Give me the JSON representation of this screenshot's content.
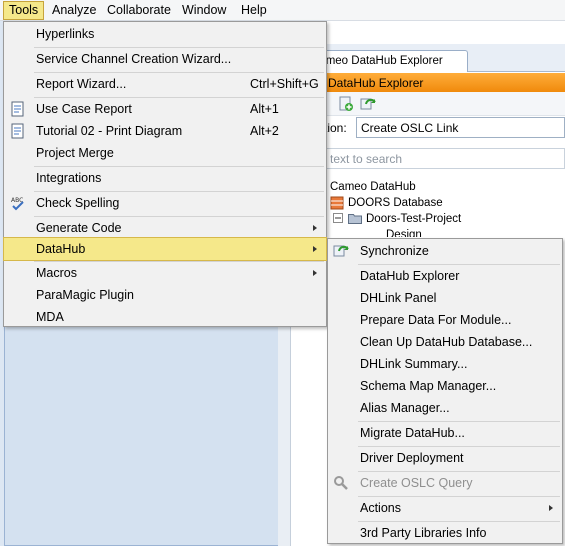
{
  "menubar": {
    "items": [
      {
        "label": "Tools"
      },
      {
        "label": "Analyze"
      },
      {
        "label": "Collaborate"
      },
      {
        "label": "Window"
      },
      {
        "label": "Help"
      }
    ]
  },
  "datahub_explorer": {
    "tab_label": "Cameo DataHub Explorer",
    "title": "DataHub Explorer",
    "action_label": "tion:",
    "action_value": "Create OSLC Link",
    "search_placeholder": "text to search",
    "tree": {
      "root": "Cameo DataHub",
      "db": "DOORS Database",
      "project": "Doors-Test-Project",
      "child": "Design"
    }
  },
  "tools_menu": {
    "items": {
      "hyperlinks": "Hyperlinks",
      "service_channel": "Service Channel Creation Wizard...",
      "report_wizard": "Report Wizard...",
      "report_wizard_sc": "Ctrl+Shift+G",
      "use_case_report": "Use Case Report",
      "use_case_report_sc": "Alt+1",
      "tutorial": "Tutorial 02 - Print Diagram",
      "tutorial_sc": "Alt+2",
      "project_merge": "Project Merge",
      "integrations": "Integrations",
      "check_spelling": "Check Spelling",
      "generate_code": "Generate Code",
      "datahub": "DataHub",
      "macros": "Macros",
      "paramagic": "ParaMagic Plugin",
      "mda": "MDA"
    }
  },
  "datahub_menu": {
    "items": {
      "synchronize": "Synchronize",
      "explorer": "DataHub Explorer",
      "dhlink_panel": "DHLink Panel",
      "prepare": "Prepare Data For Module...",
      "clean_up": "Clean Up DataHub Database...",
      "dhlink_summary": "DHLink Summary...",
      "schema_map": "Schema Map Manager...",
      "alias": "Alias Manager...",
      "migrate": "Migrate DataHub...",
      "driver": "Driver Deployment",
      "create_oslc": "Create OSLC Query",
      "actions": "Actions",
      "third_party": "3rd Party Libraries Info"
    }
  },
  "colors": {
    "highlight": "#f5e88a",
    "titlebar": "#f08a0c",
    "menu_bg": "#f1f1f1"
  }
}
